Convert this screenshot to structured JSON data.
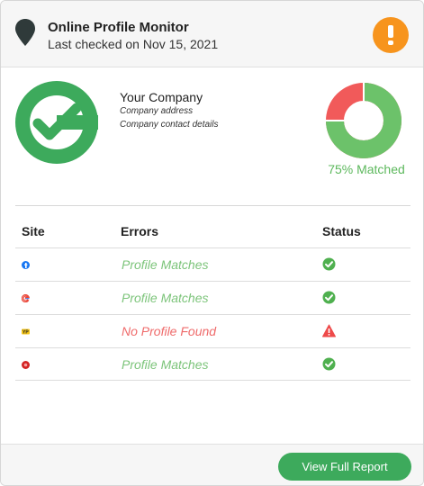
{
  "header": {
    "title": "Online Profile Monitor",
    "subtitle": "Last checked on Nov 15, 2021",
    "alert_icon": "exclamation-icon",
    "alert_color": "#f7941d"
  },
  "company": {
    "name": "Your Company",
    "address": "Company address",
    "contact": "Company contact details",
    "logo_color": "#3daa5c"
  },
  "match": {
    "label": "75% Matched",
    "matched_fraction": 0.75,
    "matched_color": "#6cc26a",
    "unmatched_color": "#f15a5a"
  },
  "table": {
    "headers": {
      "site": "Site",
      "errors": "Errors",
      "status": "Status"
    },
    "rows": [
      {
        "site_icon": "facebook-icon",
        "error": "Profile Matches",
        "status": "ok"
      },
      {
        "site_icon": "google-icon",
        "error": "Profile Matches",
        "status": "ok"
      },
      {
        "site_icon": "yellowpages-icon",
        "error": "No Profile Found",
        "status": "warning"
      },
      {
        "site_icon": "yelp-icon",
        "error": "Profile Matches",
        "status": "ok"
      }
    ]
  },
  "footer": {
    "button_label": "View Full Report"
  }
}
